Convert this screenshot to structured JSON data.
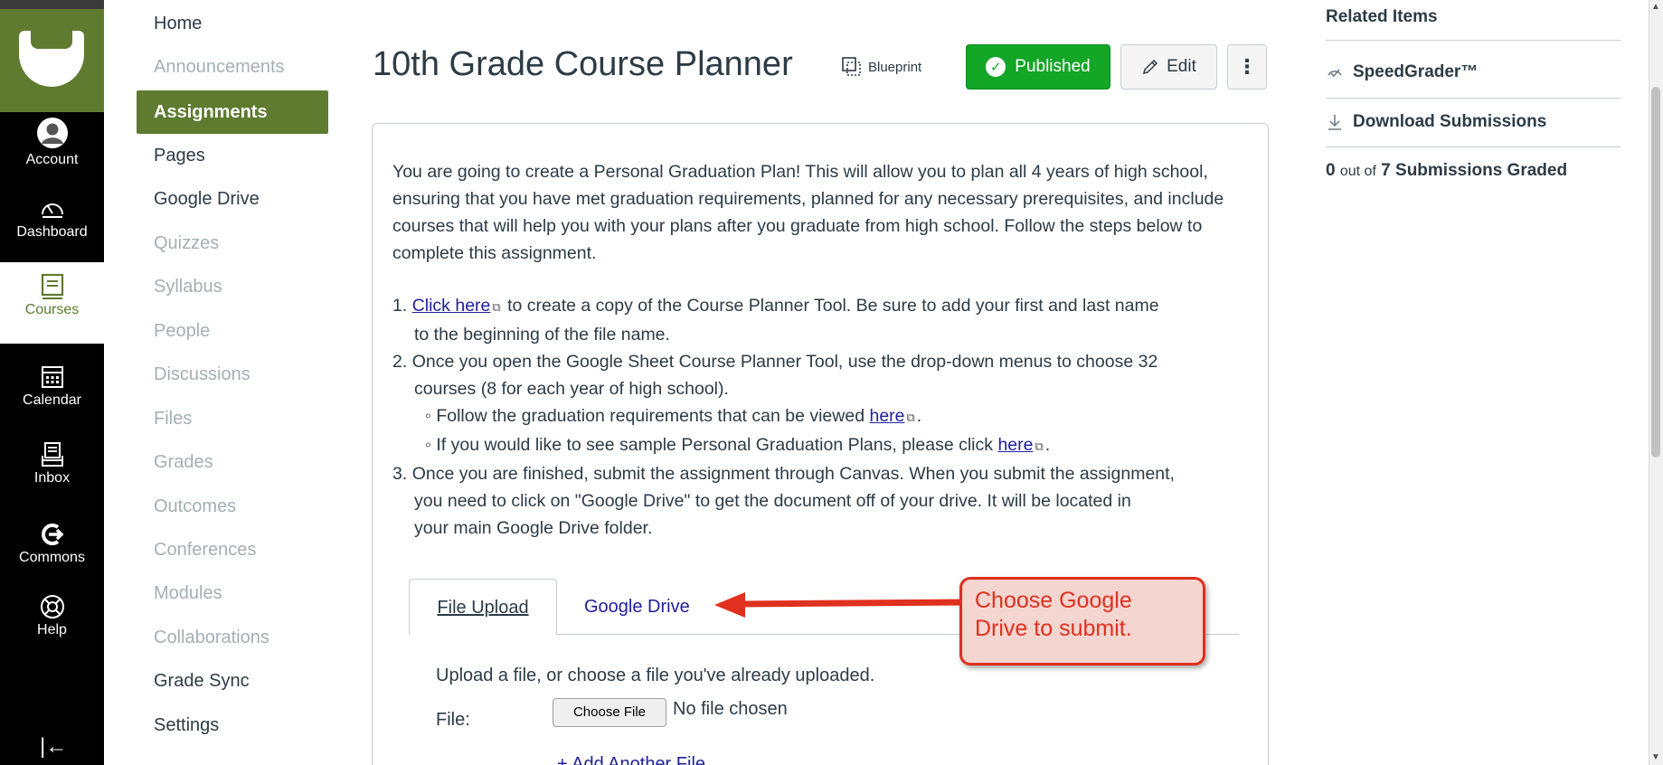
{
  "global_nav": {
    "items": [
      {
        "label": "Account",
        "icon": "account-icon"
      },
      {
        "label": "Dashboard",
        "icon": "dashboard-icon"
      },
      {
        "label": "Courses",
        "icon": "courses-icon"
      },
      {
        "label": "Calendar",
        "icon": "calendar-icon"
      },
      {
        "label": "Inbox",
        "icon": "inbox-icon"
      },
      {
        "label": "Commons",
        "icon": "commons-icon"
      },
      {
        "label": "Help",
        "icon": "help-icon"
      }
    ],
    "collapse_glyph": "|←"
  },
  "course_nav": {
    "items": [
      {
        "label": "Home"
      },
      {
        "label": "Announcements"
      },
      {
        "label": "Assignments"
      },
      {
        "label": "Pages"
      },
      {
        "label": "Google Drive"
      },
      {
        "label": "Quizzes"
      },
      {
        "label": "Syllabus"
      },
      {
        "label": "People"
      },
      {
        "label": "Discussions"
      },
      {
        "label": "Files"
      },
      {
        "label": "Grades"
      },
      {
        "label": "Outcomes"
      },
      {
        "label": "Conferences"
      },
      {
        "label": "Modules"
      },
      {
        "label": "Collaborations"
      },
      {
        "label": "Grade Sync"
      },
      {
        "label": "Settings"
      }
    ]
  },
  "header": {
    "title": "10th Grade Course Planner",
    "blueprint_label": "Blueprint",
    "published_label": "Published",
    "edit_label": "Edit",
    "more_glyph": "⋮"
  },
  "description": {
    "intro": "You are going to create a Personal Graduation Plan! This will allow you to plan all 4 years of high school, ensuring that you have met graduation requirements, planned for any necessary prerequisites, and include courses that will help you with your plans after you graduate from high school. Follow the steps below to complete this assignment.",
    "step1_num": "1.",
    "step1_link": "Click here",
    "step1_text_a": " to create a copy of the Course Planner Tool. Be sure to add your first and last name",
    "step1_text_b": "to the beginning of the file name.",
    "step2_num": "2.",
    "step2_text_a": "Once you open the Google Sheet Course Planner Tool, use the drop-down menus to choose 32",
    "step2_text_b": "courses (8 for each year of high school).",
    "bullet1_text": "Follow the graduation requirements that can be viewed",
    "bullet1_link": "here",
    "bullet2_text": "If you would like to see sample Personal Graduation Plans, please click",
    "bullet2_link": "here",
    "step3_num": "3.",
    "step3_text_a": "Once you are finished, submit the assignment through Canvas. When you submit the assignment,",
    "step3_text_b": "you need to click on \"Google Drive\" to get the document off of your drive. It will be located in",
    "step3_text_c": "your main Google Drive folder."
  },
  "submission": {
    "tab_file_upload": "File Upload",
    "tab_google_drive": "Google Drive",
    "upload_text": "Upload a file, or choose a file you've already uploaded.",
    "file_label": "File:",
    "choose_file_label": "Choose File",
    "no_file_text": "No file chosen",
    "add_another_label": "+ Add Another File"
  },
  "callout": {
    "line1": "Choose Google",
    "line2": "Drive to submit.",
    "color": "#e0301e"
  },
  "related": {
    "title": "Related Items",
    "speedgrader": "SpeedGrader™",
    "download": "Download Submissions",
    "graded_count": "0",
    "graded_outof": "out of",
    "graded_total": "7 Submissions Graded"
  },
  "colors": {
    "brand": "#5e7b30",
    "published": "#14a627",
    "link": "#1f1f9c"
  }
}
